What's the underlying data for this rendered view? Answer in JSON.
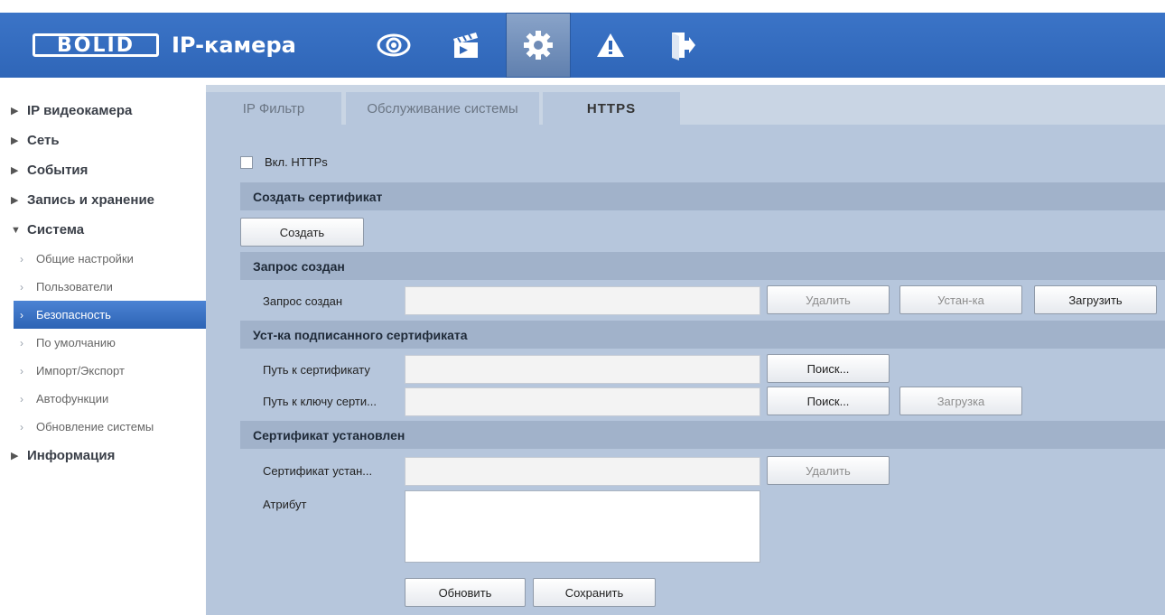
{
  "header": {
    "logo": "BOLID",
    "product": "IP-камера",
    "icons": [
      "eye-icon",
      "clapperboard-icon",
      "gear-icon",
      "warning-icon",
      "logout-icon"
    ]
  },
  "sidebar": {
    "sections": [
      {
        "label": "IP видеокамера",
        "expanded": false
      },
      {
        "label": "Сеть",
        "expanded": false
      },
      {
        "label": "События",
        "expanded": false
      },
      {
        "label": "Запись и хранение",
        "expanded": false
      },
      {
        "label": "Система",
        "expanded": true
      }
    ],
    "system_items": [
      "Общие настройки",
      "Пользователи",
      "Безопасность",
      "По умолчанию",
      "Импорт/Экспорт",
      "Автофункции",
      "Обновление системы"
    ],
    "info": "Информация"
  },
  "tabs": [
    "IP Фильтр",
    "Обслуживание системы",
    "HTTPS"
  ],
  "https": {
    "enable_label": "Вкл. HTTPs",
    "create_section": "Создать сертификат",
    "create_button": "Создать",
    "request_section": "Запрос создан",
    "request_label": "Запрос создан",
    "delete_button": "Удалить",
    "install_button": "Устан-ка",
    "download_button": "Загрузить",
    "signed_section": "Уст-ка подписанного сертификата",
    "cert_path_label": "Путь к сертификату",
    "key_path_label": "Путь к ключу серти...",
    "search_button": "Поиск...",
    "upload_button": "Загрузка",
    "installed_section": "Сертификат установлен",
    "installed_label": "Сертификат устан...",
    "attribute_label": "Атрибут",
    "refresh_button": "Обновить",
    "save_button": "Сохранить"
  }
}
